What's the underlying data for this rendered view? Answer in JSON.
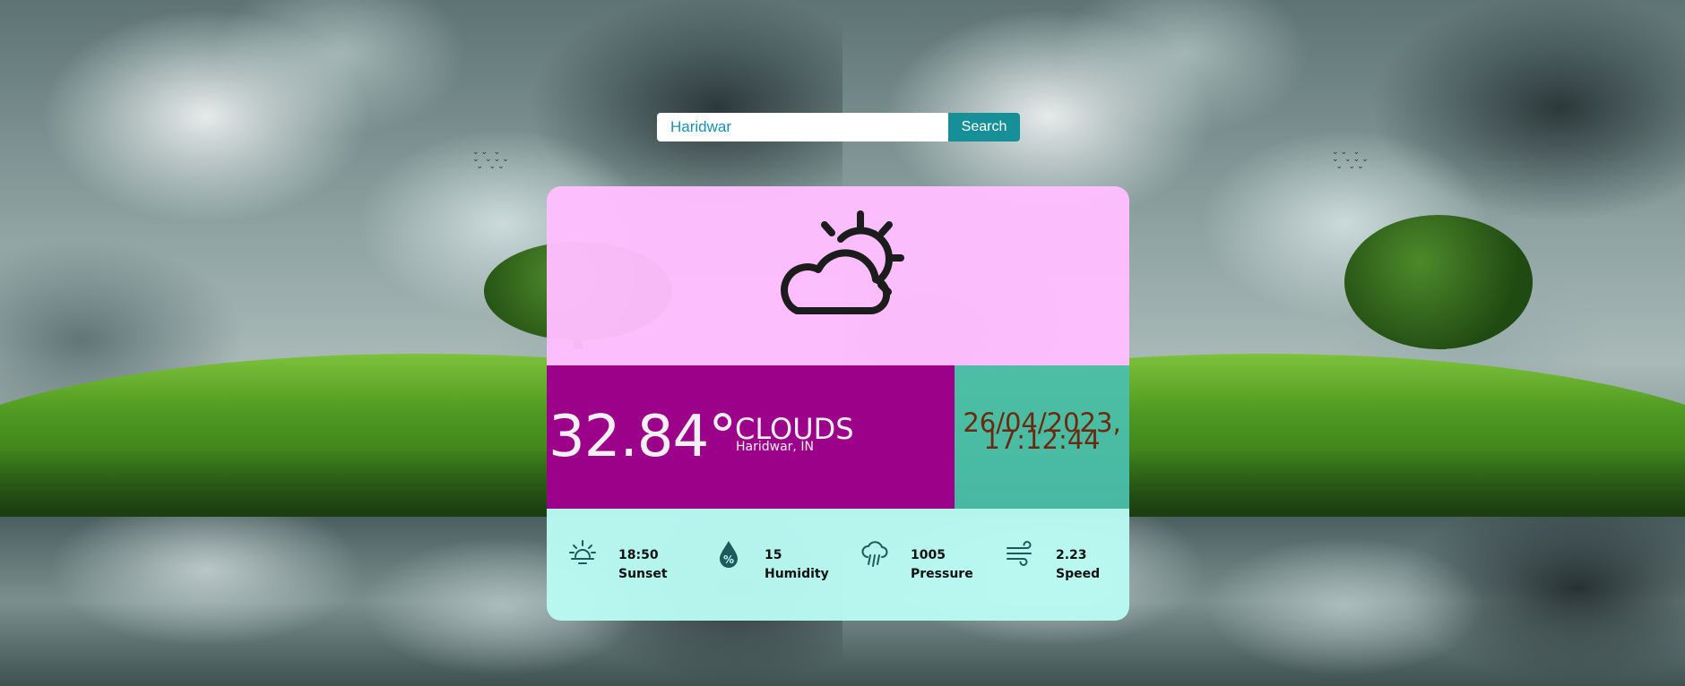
{
  "search": {
    "value": "Haridwar",
    "button_label": "Search"
  },
  "weather": {
    "icon": "partly-cloudy-icon",
    "temperature": "32.84°",
    "condition": "CLOUDS",
    "location": "Haridwar, IN",
    "date": "26/04/2023,",
    "time": "17:12:44"
  },
  "stats": [
    {
      "icon": "sunset-icon",
      "value": "18:50",
      "label": "Sunset"
    },
    {
      "icon": "humidity-icon",
      "value": "15",
      "label": "Humidity"
    },
    {
      "icon": "pressure-icon",
      "value": "1005",
      "label": "Pressure"
    },
    {
      "icon": "wind-icon",
      "value": "2.23",
      "label": "Speed"
    }
  ],
  "colors": {
    "top_panel": "#ffbeff",
    "temp_panel": "#9c0289",
    "date_panel": "#4bbfab",
    "stats_panel": "#b9faf3",
    "search_button": "#178f99",
    "date_text": "#6b2a10"
  }
}
